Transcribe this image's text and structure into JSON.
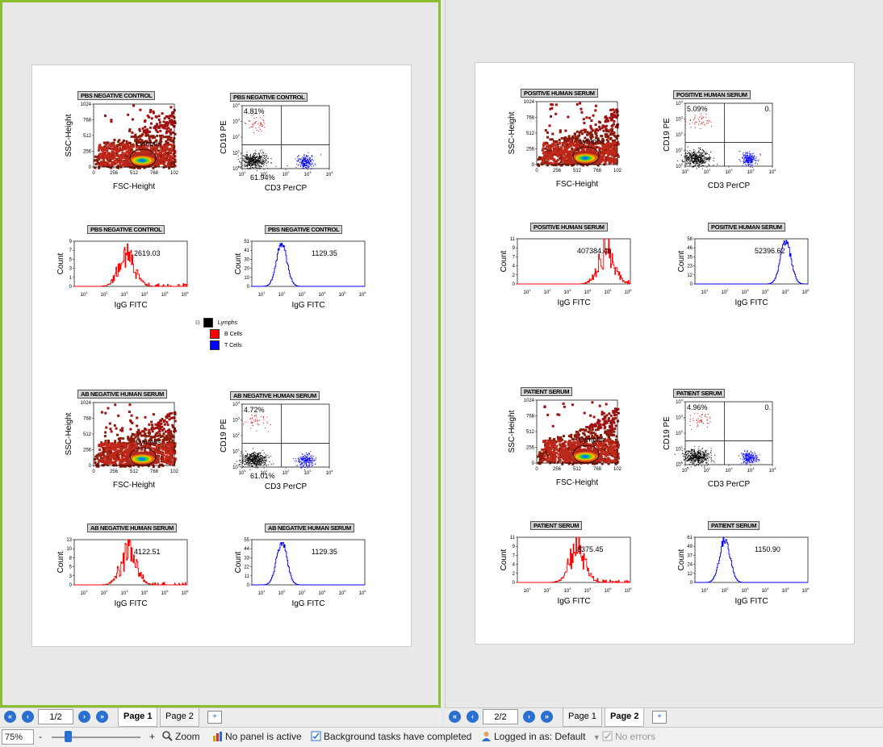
{
  "pages": [
    {
      "groups": [
        {
          "title": "PBS NEGATIVE CONTROL",
          "dot_title": "PBS NEGATIVE CONTROL",
          "quad_title": "PBS NEGATIVE CONTROL",
          "hist_b_title": "PBS NEGATIVE CONTROL",
          "hist_t_title": "PBS NEGATIVE CONTROL",
          "ul_pct": "4.81%",
          "ll_pct": "61.94%",
          "ur_pct": "",
          "gate_label": "Lymphs",
          "b_stat": "2619.03",
          "t_stat": "1129.35",
          "b_ymax": 9,
          "b_yticks": [
            "0",
            "1",
            "3",
            "5",
            "7",
            "9"
          ],
          "t_ymax": 51,
          "t_yticks": [
            "0",
            "10",
            "20",
            "30",
            "41",
            "51"
          ],
          "b_peak": 2.5,
          "t_peak": 1.2
        },
        {
          "dot_title": "AB NEGATIVE HUMAN SERUM",
          "quad_title": "AB NEGATIVE HUMAN SERUM",
          "hist_b_title": "AB NEGATIVE HUMAN SERUM",
          "hist_t_title": "AB NEGATIVE HUMAN SERUM",
          "ul_pct": "4.72%",
          "ll_pct": "61.01%",
          "ur_pct": "",
          "gate_label": "Lymphs",
          "b_stat": "4122.51",
          "t_stat": "1129.35",
          "b_ymax": 13,
          "b_yticks": [
            "0",
            "3",
            "5",
            "8",
            "10",
            "13"
          ],
          "t_ymax": 55,
          "t_yticks": [
            "0",
            "11",
            "22",
            "33",
            "44",
            "55"
          ],
          "b_peak": 2.6,
          "t_peak": 1.2
        }
      ],
      "page_input": "1/2"
    },
    {
      "groups": [
        {
          "dot_title": "POSITIVE HUMAN SERUM",
          "quad_title": "POSITIVE HUMAN SERUM",
          "hist_b_title": "POSITIVE HUMAN SERUM",
          "hist_t_title": "POSITIVE HUMAN SERUM",
          "ul_pct": "5.09%",
          "ll_pct": "",
          "ur_pct": "0.",
          "gate_label": "Lymphs",
          "b_stat": "407384.46",
          "t_stat": "52396.62",
          "b_ymax": 11,
          "b_yticks": [
            "0",
            "2",
            "4",
            "7",
            "9",
            "11"
          ],
          "t_ymax": 58,
          "t_yticks": [
            "0",
            "12",
            "23",
            "35",
            "46",
            "58"
          ],
          "b_peak": 4.6,
          "t_peak": 4.7
        },
        {
          "dot_title": "PATIENT SERUM",
          "quad_title": "PATIENT SERUM",
          "hist_b_title": "PATIENT SERUM",
          "hist_t_title": "PATIENT SERUM",
          "ul_pct": "4.96%",
          "ll_pct": "",
          "ur_pct": "0.",
          "gate_label": "Lymphs",
          "b_stat": "8375.45",
          "t_stat": "1150.90",
          "b_ymax": 11,
          "b_yticks": [
            "0",
            "2",
            "4",
            "7",
            "9",
            "11"
          ],
          "t_ymax": 61,
          "t_yticks": [
            "0",
            "12",
            "24",
            "37",
            "49",
            "61"
          ],
          "b_peak": 2.9,
          "t_peak": 1.2
        }
      ],
      "page_input": "2/2"
    }
  ],
  "axes": {
    "ssc": "SSC-Height",
    "fsc": "FSC-Height",
    "cd19": "CD19 PE",
    "cd3": "CD3 PerCP",
    "count": "Count",
    "igg": "IgG FITC",
    "scatter_ticks": [
      "0",
      "256",
      "512",
      "768",
      "102"
    ],
    "scatter_yticks": [
      "0",
      "256",
      "512",
      "768",
      "1024"
    ]
  },
  "legend": {
    "root": "Lymphs",
    "b": "B Cells",
    "t": "T Cells",
    "colors": {
      "lymphs": "#000000",
      "b": "#ff0000",
      "t": "#0000ff"
    }
  },
  "tabs": {
    "page1": "Page 1",
    "page2": "Page 2"
  },
  "status": {
    "zoom": "75%",
    "minus": "-",
    "plus": "+",
    "zoom_label": "Zoom",
    "panel": "No panel is active",
    "tasks": "Background tasks have completed",
    "login": "Logged in as: Default",
    "errors": "No errors"
  },
  "colors": {
    "active_border": "#8cbf2d",
    "accent": "#2b6fd1"
  }
}
